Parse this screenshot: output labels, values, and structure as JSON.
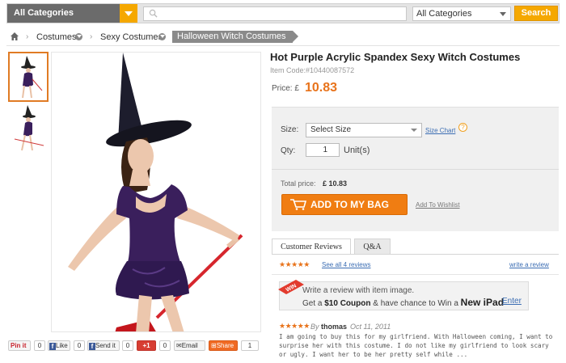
{
  "header": {
    "category_button": "All Categories",
    "search_placeholder": "",
    "category_select": "All Categories",
    "search_button": "Search"
  },
  "breadcrumb": {
    "items": [
      "Costumes",
      "Sexy Costumes"
    ],
    "current": "Halloween Witch Costumes"
  },
  "product": {
    "title": "Hot Purple Acrylic Spandex Sexy Witch Costumes",
    "item_code": "Item Code:#10440087572",
    "price_label": "Price:",
    "currency": "£",
    "price": "10.83",
    "size_label": "Size:",
    "size_value": "Select Size",
    "size_chart": "Size Chart",
    "qty_label": "Qty:",
    "qty_value": "1",
    "unit_label": "Unit(s)",
    "total_label": "Total price:",
    "total_value": "£ 10.83",
    "add_button": "ADD TO MY BAG",
    "wishlist": "Add To Wishlist"
  },
  "reviews": {
    "tabs": [
      "Customer Reviews",
      "Q&A"
    ],
    "stars": "★★★★★",
    "see_all": "See all 4 reviews",
    "write_review": "write a review",
    "promo_badge": "WIN",
    "promo_line1": "Write a review with item image.",
    "promo_get": "Get a",
    "promo_coupon": "$10 Coupon",
    "promo_mid": "& have chance to Win a",
    "promo_prize": "New iPad",
    "promo_enter": "Enter",
    "review_stars": "★★★★★",
    "review_by": "By",
    "review_user": "thomas",
    "review_date": "Oct 11, 2011",
    "review_text": "I am going to buy this for my girlfriend. With Halloween coming, I want to surprise her with this costume. I do not like my girlfriend to look scary or ugly. I want her to be her pretty self while ..."
  },
  "social": {
    "pinit": "Pin it",
    "pin_count": "0",
    "like": "Like",
    "like_count": "0",
    "send": "Send it",
    "send_count": "0",
    "gplus": "+1",
    "gplus_count": "0",
    "email": "Email",
    "share": "Share",
    "share_count": "1"
  },
  "colors": {
    "accent_orange": "#f07d12",
    "search_yellow": "#f5a800",
    "link_blue": "#3b6db3",
    "costume_purple": "#3a1f5c"
  }
}
